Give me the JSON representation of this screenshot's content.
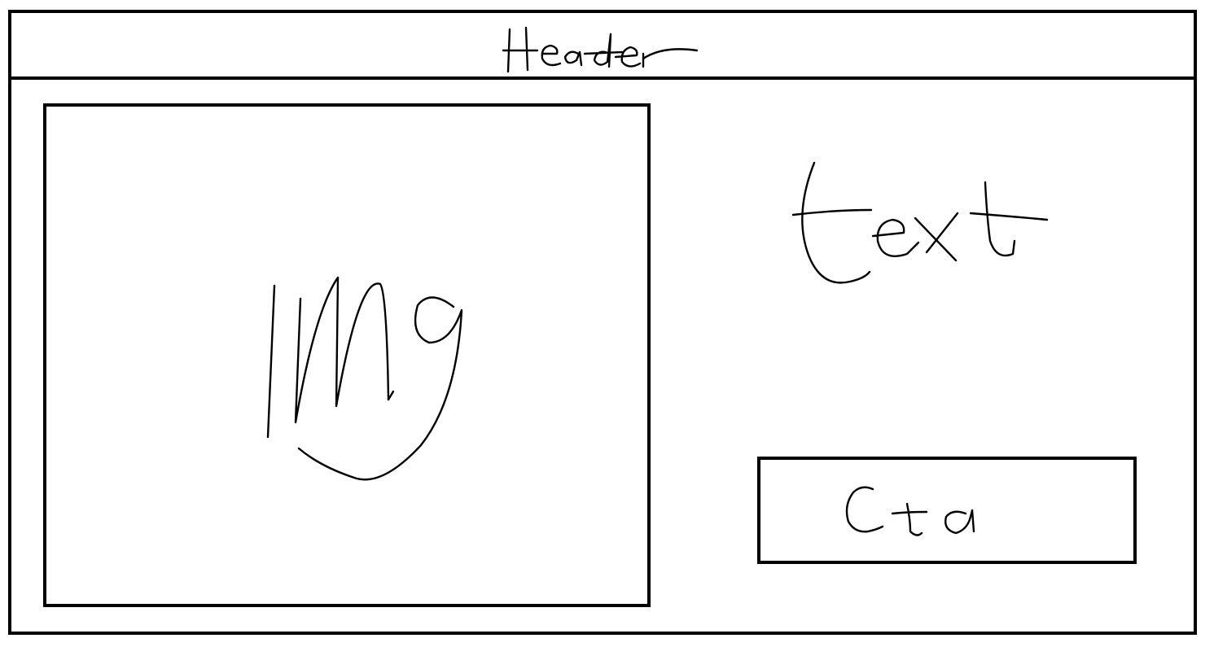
{
  "wireframe": {
    "header_label": "Header",
    "image_label": "Img",
    "text_label": "text",
    "cta_label": "Cta"
  }
}
